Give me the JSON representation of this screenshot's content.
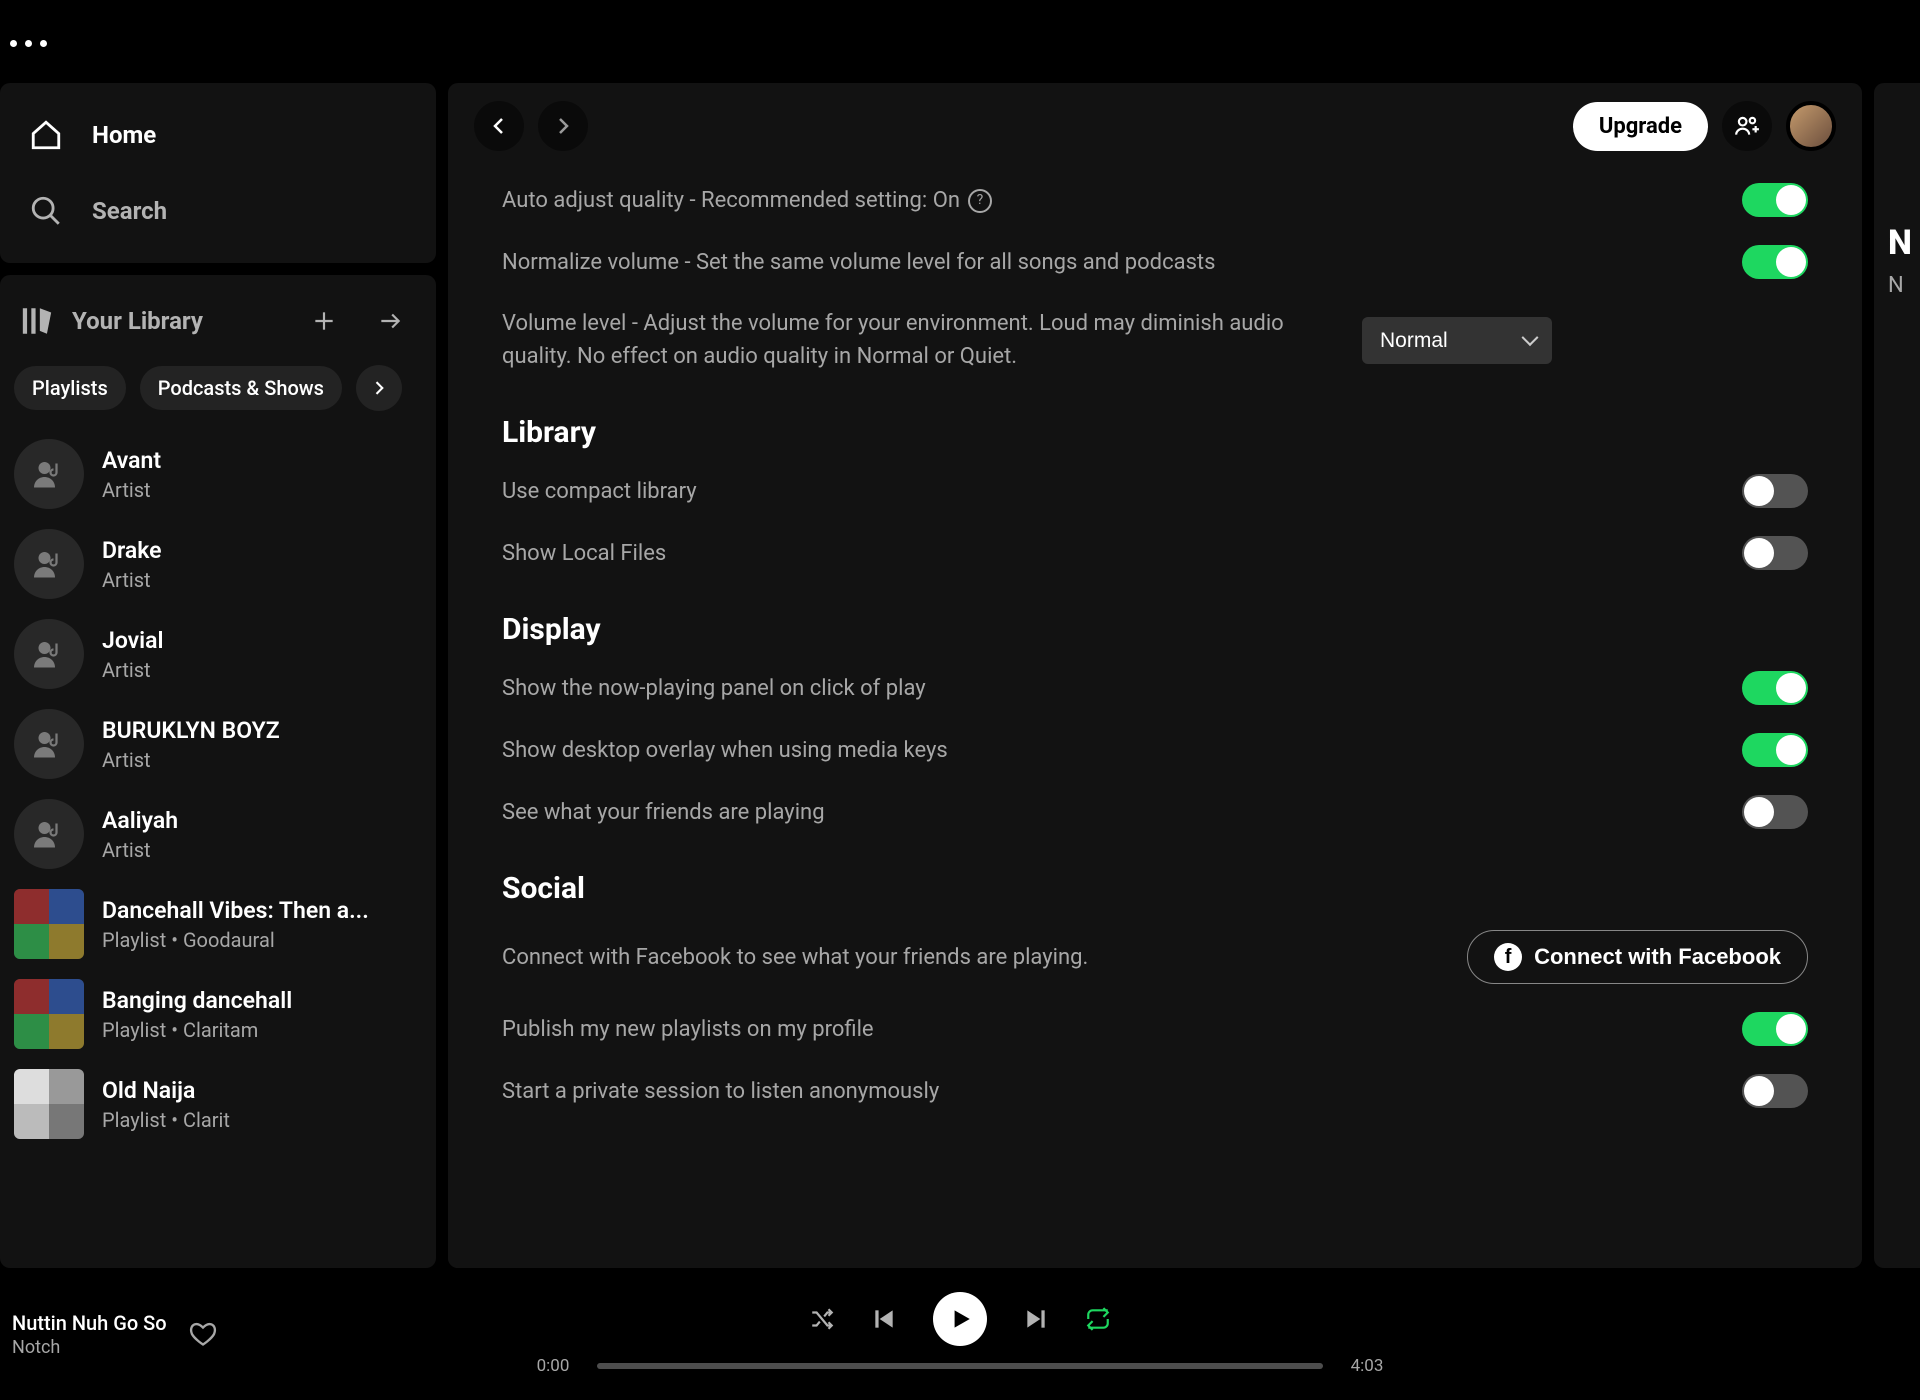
{
  "nav": {
    "home": "Home",
    "search": "Search"
  },
  "library": {
    "title": "Your Library",
    "chips": [
      "Playlists",
      "Podcasts & Shows"
    ],
    "items": [
      {
        "title": "Avant",
        "subtitle": "Artist",
        "kind": "artist"
      },
      {
        "title": "Drake",
        "subtitle": "Artist",
        "kind": "artist"
      },
      {
        "title": "Jovial",
        "subtitle": "Artist",
        "kind": "artist"
      },
      {
        "title": "BURUKLYN BOYZ",
        "subtitle": "Artist",
        "kind": "artist"
      },
      {
        "title": "Aaliyah",
        "subtitle": "Artist",
        "kind": "artist"
      },
      {
        "title": "Dancehall Vibes: Then a...",
        "subtitle": "Playlist • Goodaural",
        "kind": "playlist"
      },
      {
        "title": "Banging dancehall",
        "subtitle": "Playlist • Claritam",
        "kind": "playlist"
      },
      {
        "title": "Old Naija",
        "subtitle": "Playlist • Clarit",
        "kind": "playlist"
      }
    ]
  },
  "topbar": {
    "upgrade": "Upgrade"
  },
  "settings": {
    "audio": {
      "auto_adjust": "Auto adjust quality - Recommended setting: On",
      "normalize": "Normalize volume - Set the same volume level for all songs and podcasts",
      "volume_level": "Volume level - Adjust the volume for your environment. Loud may diminish audio quality. No effect on audio quality in Normal or Quiet.",
      "volume_select": "Normal",
      "auto_adjust_on": true,
      "normalize_on": true
    },
    "library_h": "Library",
    "library": {
      "compact": "Use compact library",
      "local": "Show Local Files",
      "compact_on": false,
      "local_on": false
    },
    "display_h": "Display",
    "display": {
      "nowplaying": "Show the now-playing panel on click of play",
      "overlay": "Show desktop overlay when using media keys",
      "friends": "See what your friends are playing",
      "nowplaying_on": true,
      "overlay_on": true,
      "friends_on": false
    },
    "social_h": "Social",
    "social": {
      "fb_text": "Connect with Facebook to see what your friends are playing.",
      "fb_btn": "Connect with Facebook",
      "publish": "Publish my new playlists on my profile",
      "private": "Start a private session to listen anonymously",
      "publish_on": true,
      "private_on": false
    }
  },
  "right": {
    "title_partial": "N",
    "sub_partial": "N"
  },
  "player": {
    "track": "Nuttin Nuh Go So",
    "artist": "Notch",
    "elapsed": "0:00",
    "total": "4:03"
  }
}
